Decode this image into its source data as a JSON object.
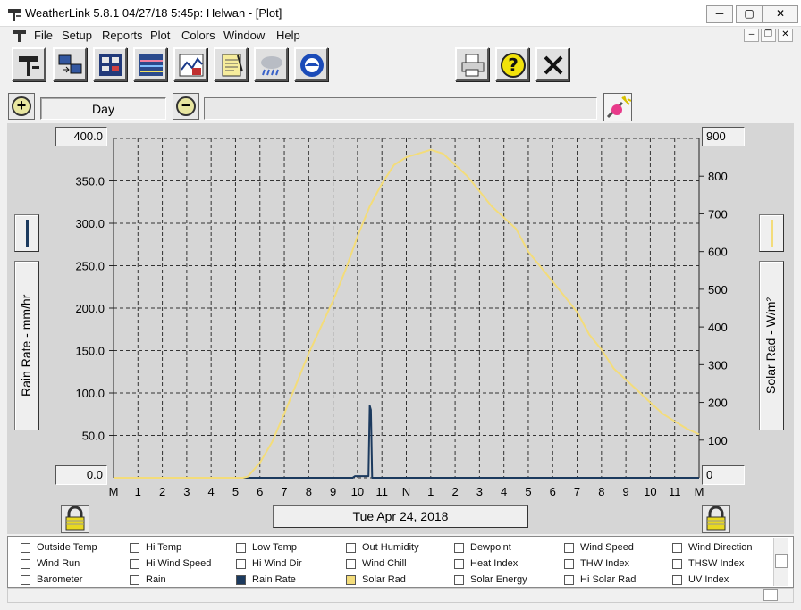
{
  "window": {
    "title": "WeatherLink 5.8.1  04/27/18  5:45p: Helwan - [Plot]",
    "minimize_glyph": "─",
    "maximize_glyph": "▢",
    "close_glyph": "✕"
  },
  "menu": {
    "items": [
      "File",
      "Setup",
      "Reports",
      "Plot",
      "Colors",
      "Window",
      "Help"
    ],
    "mdi_buttons": [
      "–",
      "❐",
      "✕"
    ]
  },
  "toolbar": {
    "buttons": [
      "station-icon",
      "data-transfer-icon",
      "bulletin-icon",
      "strip-chart-icon",
      "plot-icon",
      "notes-icon",
      "weather-icon",
      "noaa-icon",
      "print-icon",
      "help-icon",
      "close-icon"
    ]
  },
  "zoom": {
    "zoom_in_glyph": "+",
    "zoom_out_glyph": "−",
    "span": "Day"
  },
  "plot": {
    "date_label": "Tue Apr 24, 2018",
    "left_axis_label": "Rain Rate - mm/hr",
    "right_axis_label": "Solar Rad - W/m²",
    "left_top_value": "400.0",
    "right_top_value": "900"
  },
  "chart_data": {
    "type": "line",
    "x_ticks": [
      "M",
      "1",
      "2",
      "3",
      "4",
      "5",
      "6",
      "7",
      "8",
      "9",
      "10",
      "11",
      "N",
      "1",
      "2",
      "3",
      "4",
      "5",
      "6",
      "7",
      "8",
      "9",
      "10",
      "11",
      "M"
    ],
    "y_left": {
      "label": "Rain Rate - mm/hr",
      "range": [
        0,
        400
      ],
      "ticks": [
        "400.0",
        "350.0",
        "300.0",
        "250.0",
        "200.0",
        "150.0",
        "100.0",
        "50.0",
        "0.0"
      ]
    },
    "y_right": {
      "label": "Solar Rad - W/m²",
      "range": [
        0,
        900
      ],
      "ticks": [
        "900",
        "800",
        "700",
        "600",
        "500",
        "400",
        "300",
        "200",
        "100",
        "0"
      ]
    },
    "grid": true,
    "series": [
      {
        "name": "Rain Rate",
        "axis": "left",
        "color": "#1c3a5e",
        "points": [
          [
            0,
            0
          ],
          [
            9,
            0
          ],
          [
            9.3,
            0
          ],
          [
            9.6,
            0
          ],
          [
            9.8,
            0
          ],
          [
            9.9,
            2
          ],
          [
            10.3,
            2
          ],
          [
            10.45,
            2
          ],
          [
            10.5,
            85
          ],
          [
            10.55,
            80
          ],
          [
            10.6,
            0
          ],
          [
            24,
            0
          ]
        ]
      },
      {
        "name": "Solar Rad",
        "axis": "right",
        "color": "#f3dc7a",
        "points": [
          [
            0,
            0
          ],
          [
            5.3,
            0
          ],
          [
            5.5,
            3
          ],
          [
            6,
            40
          ],
          [
            6.5,
            95
          ],
          [
            7,
            170
          ],
          [
            7.5,
            250
          ],
          [
            8,
            330
          ],
          [
            8.5,
            400
          ],
          [
            9,
            470
          ],
          [
            9.5,
            550
          ],
          [
            10,
            640
          ],
          [
            10.5,
            720
          ],
          [
            11,
            780
          ],
          [
            11.5,
            830
          ],
          [
            12,
            850
          ],
          [
            12.5,
            860
          ],
          [
            13,
            870
          ],
          [
            13.5,
            860
          ],
          [
            14,
            830
          ],
          [
            14.5,
            800
          ],
          [
            15,
            760
          ],
          [
            15.5,
            720
          ],
          [
            16,
            690
          ],
          [
            16.5,
            660
          ],
          [
            17,
            600
          ],
          [
            17.5,
            560
          ],
          [
            18,
            520
          ],
          [
            18.5,
            480
          ],
          [
            19,
            440
          ],
          [
            19.5,
            380
          ],
          [
            20,
            340
          ],
          [
            20.5,
            290
          ],
          [
            21,
            260
          ],
          [
            21.5,
            230
          ],
          [
            22,
            200
          ],
          [
            22.5,
            170
          ],
          [
            23,
            150
          ],
          [
            23.5,
            130
          ],
          [
            24,
            115
          ]
        ]
      }
    ]
  },
  "selector": {
    "options": [
      {
        "label": "Outside Temp",
        "checked": false,
        "color": ""
      },
      {
        "label": "Hi Temp",
        "checked": false,
        "color": ""
      },
      {
        "label": "Low Temp",
        "checked": false,
        "color": ""
      },
      {
        "label": "Out Humidity",
        "checked": false,
        "color": ""
      },
      {
        "label": "Dewpoint",
        "checked": false,
        "color": ""
      },
      {
        "label": "Wind Speed",
        "checked": false,
        "color": ""
      },
      {
        "label": "Wind Direction",
        "checked": false,
        "color": ""
      },
      {
        "label": "Wind Run",
        "checked": false,
        "color": ""
      },
      {
        "label": "Hi Wind Speed",
        "checked": false,
        "color": ""
      },
      {
        "label": "Hi Wind Dir",
        "checked": false,
        "color": ""
      },
      {
        "label": "Wind Chill",
        "checked": false,
        "color": ""
      },
      {
        "label": "Heat Index",
        "checked": false,
        "color": ""
      },
      {
        "label": "THW Index",
        "checked": false,
        "color": ""
      },
      {
        "label": "THSW Index",
        "checked": false,
        "color": ""
      },
      {
        "label": "Barometer",
        "checked": false,
        "color": ""
      },
      {
        "label": "Rain",
        "checked": false,
        "color": ""
      },
      {
        "label": "Rain Rate",
        "checked": true,
        "color": "#1c3a5e"
      },
      {
        "label": "Solar Rad",
        "checked": true,
        "color": "#f3dc7a"
      },
      {
        "label": "Solar Energy",
        "checked": false,
        "color": ""
      },
      {
        "label": "Hi Solar Rad",
        "checked": false,
        "color": ""
      },
      {
        "label": "UV Index",
        "checked": false,
        "color": ""
      }
    ]
  }
}
